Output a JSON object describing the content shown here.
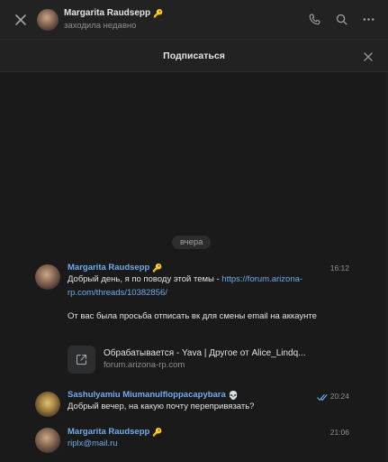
{
  "header": {
    "contact_name": "Margarita Raudsepp",
    "contact_emoji": "🔑",
    "status": "заходила недавно",
    "icons": [
      "close-icon",
      "phone-icon",
      "search-icon",
      "more-icon"
    ]
  },
  "subscribe_bar": {
    "label": "Подписаться"
  },
  "date_separator": "вчера",
  "messages": [
    {
      "author": "Margarita Raudsepp",
      "author_emoji": "🔑",
      "time": "16:12",
      "text_before_link": "Добрый день, я по поводу этой темы - ",
      "link": "https://forum.arizona-rp.com/threads/10382856/",
      "text_after": "От вас была просьба отписать вк для смены email на аккаунте",
      "snippet": {
        "title": "Обрабатывается - Yava | Другое от Alice_Lindq...",
        "domain": "forum.arizona-rp.com"
      }
    },
    {
      "author": "Sashulyamiu Miumanulfloppacapybara",
      "author_emoji": "💀",
      "time": "20:24",
      "text": "Добрый вечер, на какую почту перепривязать?",
      "status": "read"
    },
    {
      "author": "Margarita Raudsepp",
      "author_emoji": "🔑",
      "time": "21:06",
      "link": "riplx@mail.ru"
    }
  ],
  "colors": {
    "background": "#1a1a1a",
    "header": "#222222",
    "accent": "#71aaeb",
    "text": "#e1e3e6",
    "muted": "#8c8f94"
  }
}
